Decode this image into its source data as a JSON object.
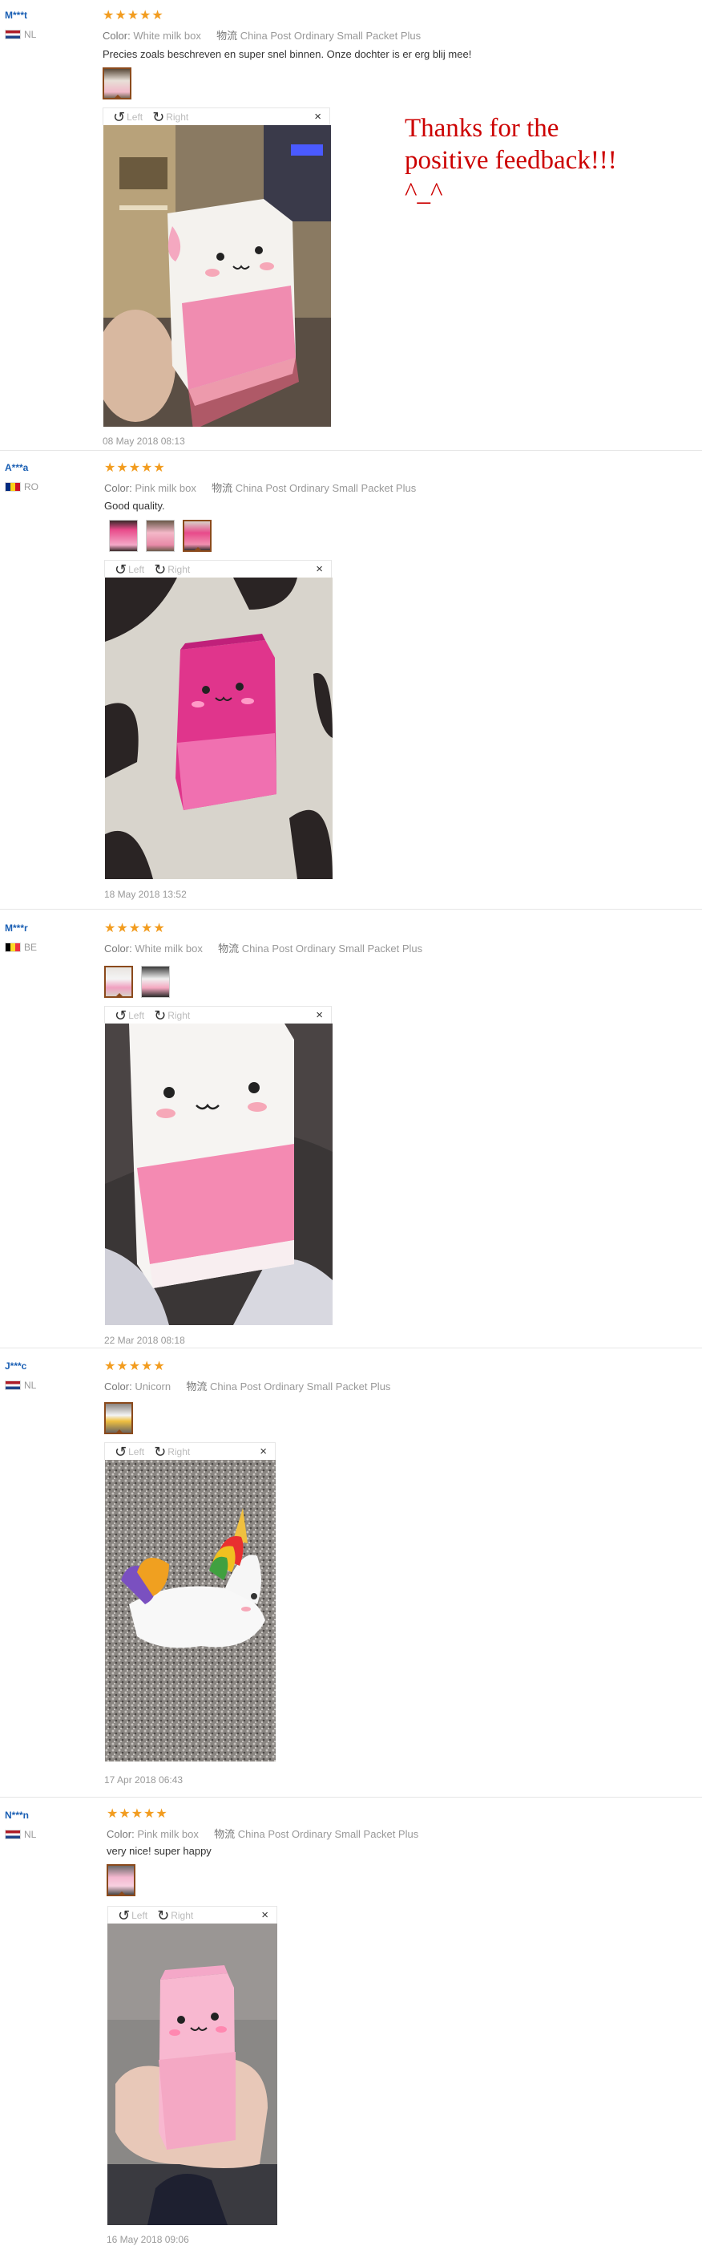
{
  "seller_note": "Thanks for the\npositive feedback!!!\n^_^",
  "labels": {
    "color": "Color:",
    "shipping_logistics": "物流",
    "rotate_left": "Left",
    "rotate_right": "Right",
    "close": "×",
    "stars": "★★★★★"
  },
  "icons": {
    "rotate_left": "rotate-left-icon",
    "rotate_right": "rotate-right-icon",
    "close": "close-icon",
    "star": "star-icon"
  },
  "colors": {
    "username": "#1a5fb4",
    "stars": "#f29c1f",
    "seller_note": "#cc0000",
    "selected_thumb_border": "#8b4a1c"
  },
  "reviews": [
    {
      "user": "M***t",
      "country": "NL",
      "rating": 5,
      "color": "White milk box",
      "shipping": "China Post Ordinary Small Packet Plus",
      "text": "Precies zoals beschreven en super snel binnen. Onze dochter is er erg blij mee!",
      "thumb_count": 1,
      "date": "08 May 2018 08:13"
    },
    {
      "user": "A***a",
      "country": "RO",
      "rating": 5,
      "color": "Pink milk box",
      "shipping": "China Post Ordinary Small Packet Plus",
      "text": "Good quality.",
      "thumb_count": 3,
      "date": "18 May 2018 13:52"
    },
    {
      "user": "M***r",
      "country": "BE",
      "rating": 5,
      "color": "White milk box",
      "shipping": "China Post Ordinary Small Packet Plus",
      "text": "",
      "thumb_count": 2,
      "date": "22 Mar 2018 08:18"
    },
    {
      "user": "J***c",
      "country": "NL",
      "rating": 5,
      "color": "Unicorn",
      "shipping": "China Post Ordinary Small Packet Plus",
      "text": "",
      "thumb_count": 1,
      "date": "17 Apr 2018 06:43"
    },
    {
      "user": "N***n",
      "country": "NL",
      "rating": 5,
      "color": "Pink milk box",
      "shipping": "China Post Ordinary Small Packet Plus",
      "text": "very nice! super happy",
      "thumb_count": 1,
      "date": "16 May 2018 09:06"
    }
  ]
}
